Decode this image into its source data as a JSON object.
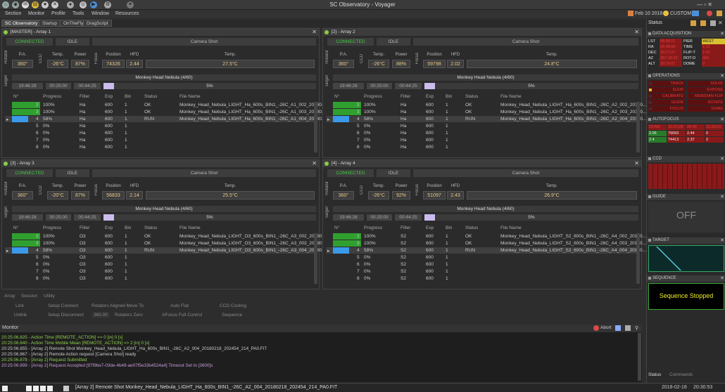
{
  "app": {
    "title": "SC Observatory - Voyager"
  },
  "menu": [
    "Section",
    "Monitor",
    "Profile",
    "Tools",
    "Window",
    "Resources"
  ],
  "topright": {
    "date": "Feb 10 2018",
    "profile": "CUSTOM"
  },
  "tabs": [
    "SC Observatory",
    "Startup",
    "OnTheFly",
    "DragScript"
  ],
  "arrays": [
    {
      "title": "[MASTER] - Array 1",
      "connected": "CONNECTED",
      "idle": "IDLE",
      "shot": "Camera Shot",
      "rotator_label": "Rotator",
      "pa_label": "P.A.",
      "pa": "360°",
      "ccd_label": "CCD",
      "temp_label": "Temp.",
      "temp": "-26°C",
      "power_label": "Power",
      "power": "87%",
      "focus_label": "Focus",
      "position_label": "Position",
      "position": "74326",
      "hfd_label": "HFD",
      "hfd": "2.44",
      "ftemp_label": "Temp.",
      "ftemp": "27.5°C",
      "target_label": "Target",
      "target": "Monkey Head Nebula (4/60)",
      "t1": "19:46:28",
      "t2": "00:25:00",
      "t3": "00:44:25",
      "progress": "5%",
      "progress_frac": 0.05,
      "cols": [
        "N°",
        "Progress",
        "Filter",
        "Exp",
        "Bin",
        "Status",
        "File Name"
      ],
      "rows": [
        [
          "2",
          "100%",
          "Ha",
          "600",
          "1",
          "OK",
          "Monkey_Head_Nebula_LIGHT_Ha_600s_BIN1_-26C_A1_002_20180..."
        ],
        [
          "3",
          "100%",
          "Ha",
          "600",
          "1",
          "OK",
          "Monkey_Head_Nebula_LIGHT_Ha_600s_BIN1_-26C_A1_003_20180..."
        ],
        [
          "4",
          "58%",
          "Ha",
          "600",
          "1",
          "RUN",
          "Monkey_Head_Nebula_LIGHT_Ha_600s_BIN1_-26C_A1_004_20180..."
        ],
        [
          "5",
          "0%",
          "Ha",
          "600",
          "1",
          "",
          ""
        ],
        [
          "6",
          "0%",
          "Ha",
          "600",
          "1",
          "",
          ""
        ],
        [
          "7",
          "0%",
          "Ha",
          "600",
          "1",
          "",
          ""
        ],
        [
          "8",
          "0%",
          "Ha",
          "600",
          "1",
          "",
          ""
        ]
      ],
      "fills": [
        1,
        1,
        0.58,
        0,
        0,
        0,
        0
      ]
    },
    {
      "title": "[2] - Array 2",
      "connected": "CONNECTED",
      "idle": "IDLE",
      "shot": "Camera Shot",
      "rotator_label": "Rotator",
      "pa_label": "P.A.",
      "pa": "360°",
      "ccd_label": "CCD",
      "temp_label": "Temp.",
      "temp": "-26°C",
      "power_label": "Power",
      "power": "88%",
      "focus_label": "Focus",
      "position_label": "Position",
      "position": "59798",
      "hfd_label": "HFD",
      "hfd": "2.02",
      "ftemp_label": "Temp.",
      "ftemp": "24.8°C",
      "target_label": "Target",
      "target": "Monkey Head Nebula (4/60)",
      "t1": "19:46:28",
      "t2": "00:25:00",
      "t3": "00:44:25",
      "progress": "5%",
      "progress_frac": 0.05,
      "cols": [
        "N°",
        "Progress",
        "Filter",
        "Exp",
        "Bin",
        "Status",
        "File Name"
      ],
      "rows": [
        [
          "2",
          "100%",
          "Ha",
          "600",
          "1",
          "OK",
          "Monkey_Head_Nebula_LIGHT_Ha_600s_BIN1_-26C_A2_002_20180..."
        ],
        [
          "3",
          "100%",
          "Ha",
          "600",
          "1",
          "OK",
          "Monkey_Head_Nebula_LIGHT_Ha_600s_BIN1_-26C_A2_003_20180..."
        ],
        [
          "4",
          "58%",
          "Ha",
          "600",
          "1",
          "RUN",
          "Monkey_Head_Nebula_LIGHT_Ha_600s_BIN1_-26C_A2_004_20180..."
        ],
        [
          "5",
          "0%",
          "Ha",
          "600",
          "1",
          "",
          ""
        ],
        [
          "6",
          "0%",
          "Ha",
          "600",
          "1",
          "",
          ""
        ],
        [
          "7",
          "0%",
          "Ha",
          "600",
          "1",
          "",
          ""
        ],
        [
          "8",
          "0%",
          "Ha",
          "600",
          "1",
          "",
          ""
        ]
      ],
      "fills": [
        1,
        1,
        0.58,
        0,
        0,
        0,
        0
      ]
    },
    {
      "title": "[3] - Array 3",
      "connected": "CONNECTED",
      "idle": "IDLE",
      "shot": "Camera Shot",
      "rotator_label": "Rotator",
      "pa_label": "P.A.",
      "pa": "360°",
      "ccd_label": "CCD",
      "temp_label": "Temp.",
      "temp": "-20°C",
      "power_label": "Power",
      "power": "87%",
      "focus_label": "Focus",
      "position_label": "Position",
      "position": "56833",
      "hfd_label": "HFD",
      "hfd": "2.14",
      "ftemp_label": "Temp.",
      "ftemp": "25.5°C",
      "target_label": "Target",
      "target": "Monkey Head Nebula (4/60)",
      "t1": "19:46:28",
      "t2": "00:25:00",
      "t3": "00:44:25",
      "progress": "5%",
      "progress_frac": 0.05,
      "cols": [
        "N°",
        "Progress",
        "Filter",
        "Exp",
        "Bin",
        "Status",
        "File Name"
      ],
      "rows": [
        [
          "2",
          "100%",
          "O3",
          "600",
          "1",
          "OK",
          "Monkey_Head_Nebula_LIGHT_O3_600s_BIN1_-26C_A3_002_20180..."
        ],
        [
          "3",
          "100%",
          "O3",
          "600",
          "1",
          "OK",
          "Monkey_Head_Nebula_LIGHT_O3_600s_BIN1_-26C_A3_003_20180..."
        ],
        [
          "4",
          "58%",
          "O3",
          "600",
          "1",
          "RUN",
          "Monkey_Head_Nebula_LIGHT_O3_600s_BIN1_-26C_A3_004_20180..."
        ],
        [
          "5",
          "0%",
          "O3",
          "600",
          "1",
          "",
          ""
        ],
        [
          "6",
          "0%",
          "O3",
          "600",
          "1",
          "",
          ""
        ],
        [
          "7",
          "0%",
          "O3",
          "600",
          "1",
          "",
          ""
        ],
        [
          "8",
          "0%",
          "O3",
          "600",
          "1",
          "",
          ""
        ]
      ],
      "fills": [
        1,
        1,
        0.58,
        0,
        0,
        0,
        0
      ]
    },
    {
      "title": "[4] - Array 4",
      "connected": "CONNECTED",
      "idle": "IDLE",
      "shot": "Camera Shot",
      "rotator_label": "Rotator",
      "pa_label": "P.A.",
      "pa": "360°",
      "ccd_label": "CCD",
      "temp_label": "Temp.",
      "temp": "-26°C",
      "power_label": "Power",
      "power": "92%",
      "focus_label": "Focus",
      "position_label": "Position",
      "position": "51097",
      "hfd_label": "HFD",
      "hfd": "2.43",
      "ftemp_label": "Temp.",
      "ftemp": "26.9°C",
      "target_label": "Target",
      "target": "Monkey Head Nebula (4/60)",
      "t1": "19:46:28",
      "t2": "00:25:00",
      "t3": "00:44:25",
      "progress": "5%",
      "progress_frac": 0.05,
      "cols": [
        "N°",
        "Progress",
        "Filter",
        "Exp",
        "Bin",
        "Status",
        "File Name"
      ],
      "rows": [
        [
          "2",
          "100%",
          "S2",
          "600",
          "1",
          "OK",
          "Monkey_Head_Nebula_LIGHT_S2_600s_BIN1_-26C_A4_002_20180..."
        ],
        [
          "3",
          "100%",
          "S2",
          "600",
          "1",
          "OK",
          "Monkey_Head_Nebula_LIGHT_S2_600s_BIN1_-26C_A4_003_20180..."
        ],
        [
          "4",
          "58%",
          "S2",
          "600",
          "1",
          "RUN",
          "Monkey_Head_Nebula_LIGHT_S2_600s_BIN1_-26C_A4_004_20180..."
        ],
        [
          "5",
          "0%",
          "S2",
          "600",
          "1",
          "",
          ""
        ],
        [
          "6",
          "0%",
          "S2",
          "600",
          "1",
          "",
          ""
        ],
        [
          "7",
          "0%",
          "S2",
          "600",
          "1",
          "",
          ""
        ],
        [
          "8",
          "0%",
          "S2",
          "600",
          "1",
          "",
          ""
        ]
      ],
      "fills": [
        1,
        1,
        0.58,
        0,
        0,
        0,
        0
      ]
    }
  ],
  "ctrl": {
    "tabs": [
      "Array",
      "Session",
      "Utility"
    ],
    "buttons": [
      "Link",
      "Setup Connect",
      "Rotators Aligned Move To",
      "Auto Flat",
      "CCD Cooling",
      "Unlink",
      "Setup Disconnect",
      "360.00",
      "Rotators Zero",
      "AFocus Full Control",
      "Sequence"
    ]
  },
  "monitor": {
    "title": "Monitor",
    "abort": "Abort",
    "lines": [
      {
        "t": "20:25:06.825 - Action Time [REMOTE_ACTION] => 0 [in] 0 [s]",
        "c": "#8fcf4f"
      },
      {
        "t": "20:25:06.840 - Action Time Mobile Mean [REMOTE_ACTION] => 2 [in] 0 [s]",
        "c": "#8fcf4f"
      },
      {
        "t": "20:25:06.855 - [Array 2] Remote Shot Monkey_Head_Nebula_LIGHT_Ha_600s_BIN1_-26C_A2_004_20180218_202454_214_PA0.FIT",
        "c": "#cccccc"
      },
      {
        "t": "20:25:06.867 - [Array 2] Remote Action request [Camera Shot] ready",
        "c": "#cccccc"
      },
      {
        "t": "20:25:06.878 - [Array 2] Request Submitted",
        "c": "#8fcf4f"
      },
      {
        "t": "20:25:06.899 - [Array 2] Request Accepted [97f9be7-03de-4b49-ae07f5e33b4524a4] Timeout Set to [3600]s",
        "c": "#c89ad8"
      }
    ]
  },
  "statusbar": {
    "msg": "[Array 2] Remote Shot Monkey_Head_Nebula_LIGHT_Ha_600s_BIN1_-26C_A2_004_20180218_202454_214_PA0.FIT",
    "date": "2018-02-18",
    "time": "20:30:53"
  },
  "right": {
    "title": "Status",
    "sections": [
      "DATA ACQUISITION",
      "OPERATIONS",
      "AUTOFOCUS",
      "CCD",
      "GUIDE",
      "TARGET",
      "SEQUENCE"
    ],
    "da": [
      [
        "LST",
        "06:58:11",
        "PIER",
        "WEST"
      ],
      [
        "RA",
        "06:08:06",
        "TIME",
        "1:13"
      ],
      [
        "DEC",
        "20:27:27",
        "FLIP-T",
        "1:41"
      ],
      [
        "AZ",
        "297:18:23",
        "ROT-D",
        "360"
      ],
      [
        "ALT",
        "30:10:07",
        "DOME",
        "0"
      ]
    ],
    "ops": [
      [
        "TRACK",
        "SOLVE"
      ],
      [
        "SLEW",
        "EXPOSE"
      ],
      [
        "CALIBRATE",
        "MERIDIAN FLIP"
      ],
      [
        "GUIDE",
        "ROTATE"
      ],
      [
        "FOCUS",
        "DOME"
      ]
    ],
    "af": [
      [
        "DONE",
        "20:22:28",
        "00:48",
        "22:28:21"
      ],
      [
        "2.06",
        "79093",
        "2.44",
        "0"
      ],
      [
        "2.4",
        "74413",
        "2.37",
        "2"
      ]
    ],
    "guide": "OFF",
    "sequence": "Sequence Stopped",
    "bottom_tabs": [
      "Status",
      "Commands"
    ]
  }
}
